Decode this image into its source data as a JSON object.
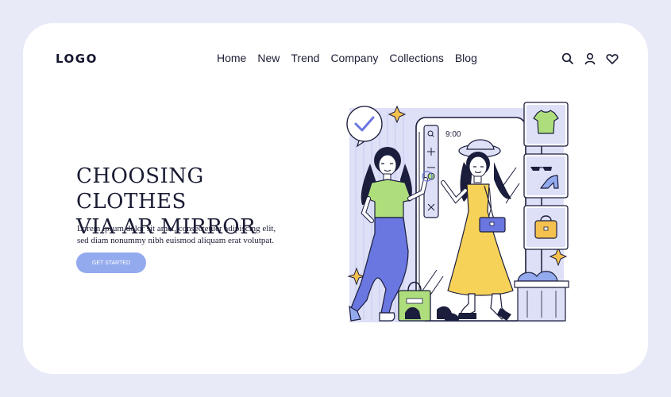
{
  "header": {
    "logo": "LOGO",
    "nav": [
      "Home",
      "New",
      "Trend",
      "Company",
      "Collections",
      "Blog"
    ],
    "icons": [
      "search-icon",
      "user-icon",
      "heart-icon"
    ]
  },
  "hero": {
    "title_lines": [
      "CHOOSING CLOTHES",
      "VIA AR MIRROR"
    ],
    "description_lines": [
      "Lorem ipsum dolor sit amet, consectetuer adipiscing elit,",
      "sed diam nonummy nibh euismod aliquam erat volutpat."
    ],
    "cta_label": "GET STARTED"
  },
  "illustration": {
    "mirror_time": "9:00",
    "colors": {
      "accent_blue": "#94aaee",
      "pants_blue": "#6a77e0",
      "shirt_green": "#aede7c",
      "dress_yellow": "#f7d258",
      "bag_orange": "#f4c14f",
      "panel_lavender": "#dde0f7",
      "outline": "#1b1d3c"
    }
  }
}
